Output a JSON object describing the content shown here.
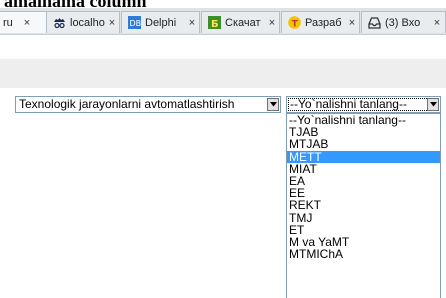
{
  "page": {
    "heading": "amalnama column"
  },
  "browser": {
    "tabs": [
      {
        "label": "ru",
        "icon": "page-icon",
        "active": true
      },
      {
        "label": "localho",
        "icon": "incognito-icon",
        "active": false
      },
      {
        "label": "Delphi",
        "icon": "delphi-icon",
        "active": false
      },
      {
        "label": "Скачат",
        "icon": "download-b-icon",
        "active": false
      },
      {
        "label": "Разраб",
        "icon": "razrab-t-icon",
        "active": false
      },
      {
        "label": "(3) Вхо",
        "icon": "inbox-icon",
        "active": false
      }
    ],
    "close_glyph": "×"
  },
  "form": {
    "department_select": {
      "value": "Texnologik jarayonlarni avtomatlashtirish"
    },
    "direction_select": {
      "value": "--Yo`nalishni tanlang--",
      "options": [
        "--Yo`nalishni tanlang--",
        "TJAB",
        "MTJAB",
        "METT",
        "MIAT",
        "EA",
        "EE",
        "REKT",
        "TMJ",
        "ET",
        "M va YaMT",
        "MTMIChA"
      ],
      "highlighted_index": 3
    }
  },
  "colors": {
    "highlight": "#3399ff",
    "select_border": "#7f9db9",
    "toolbar_band": "#eeeeee"
  }
}
